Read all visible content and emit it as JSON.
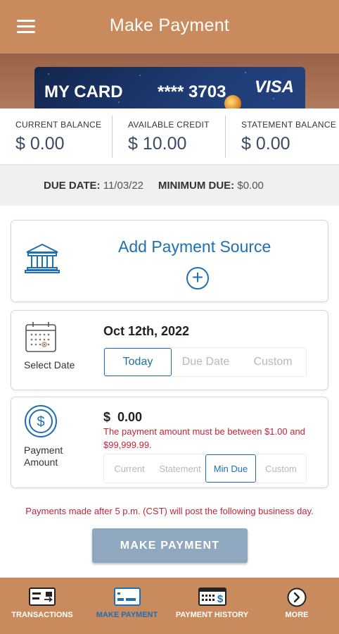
{
  "header": {
    "title": "Make Payment"
  },
  "card": {
    "name": "MY CARD",
    "number": "**** 3703",
    "network": "VISA"
  },
  "balances": [
    {
      "label": "CURRENT BALANCE",
      "value": "$ 0.00"
    },
    {
      "label": "AVAILABLE CREDIT",
      "value": "$ 10.00"
    },
    {
      "label": "STATEMENT BALANCE",
      "value": "$ 0.00"
    }
  ],
  "due": {
    "due_date_label": "DUE DATE:",
    "due_date_value": "11/03/22",
    "min_due_label": "MINIMUM DUE:",
    "min_due_value": "$0.00"
  },
  "payment_source": {
    "title": "Add Payment Source",
    "plus": "+"
  },
  "date_section": {
    "label": "Select Date",
    "value": "Oct 12th, 2022",
    "options": [
      "Today",
      "Due Date",
      "Custom"
    ],
    "selected": "Today"
  },
  "amount_section": {
    "label_line1": "Payment",
    "label_line2": "Amount",
    "value": "$  0.00",
    "error": "The payment amount must be between $1.00 and $99,999.99.",
    "options": [
      "Current",
      "Statement",
      "Min Due",
      "Custom"
    ],
    "selected": "Min Due"
  },
  "notice": "Payments made after 5 p.m. (CST) will post the following business day.",
  "make_payment_button": "MAKE PAYMENT",
  "bottom_nav": [
    {
      "label": "TRANSACTIONS",
      "icon": "transactions-card-icon"
    },
    {
      "label": "MAKE PAYMENT",
      "icon": "make-payment-card-icon",
      "active": true
    },
    {
      "label": "PAYMENT HISTORY",
      "icon": "payment-history-icon"
    },
    {
      "label": "MORE",
      "icon": "chevron-right-circle-icon"
    }
  ],
  "colors": {
    "brand": "#c98a5e",
    "accent": "#1f6fb2",
    "error": "#c0263a",
    "button": "#8fa8bf"
  }
}
